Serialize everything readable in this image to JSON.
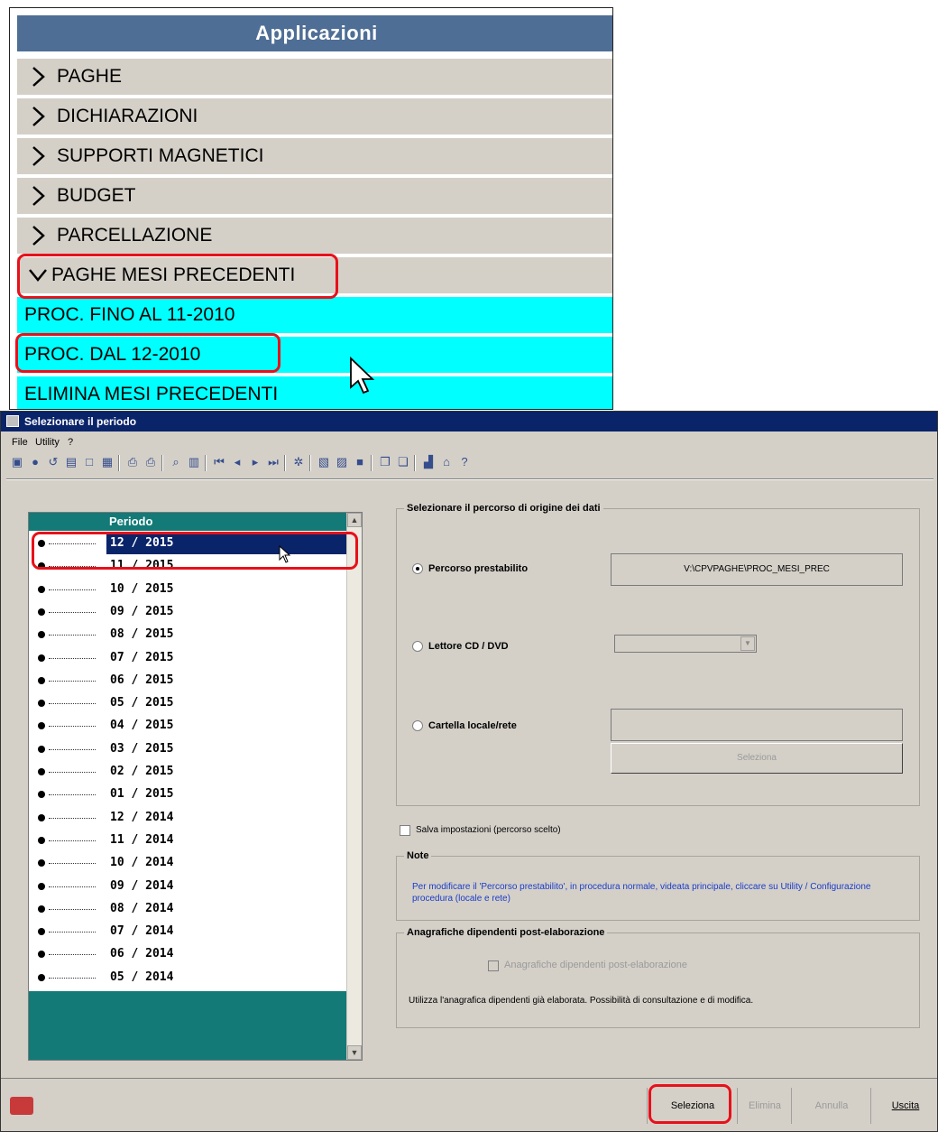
{
  "apps": {
    "header": "Applicazioni",
    "items": [
      {
        "label": "PAGHE"
      },
      {
        "label": "DICHIARAZIONI"
      },
      {
        "label": "SUPPORTI MAGNETICI"
      },
      {
        "label": "BUDGET"
      },
      {
        "label": "PARCELLAZIONE"
      },
      {
        "label": "PAGHE MESI PRECEDENTI"
      }
    ],
    "subitems": [
      {
        "label": "PROC. FINO AL 11-2010"
      },
      {
        "label": "PROC. DAL 12-2010"
      },
      {
        "label": "ELIMINA MESI PRECEDENTI"
      }
    ],
    "highlight_color": "#e8101a",
    "subitem_color": "#00ffff",
    "header_color": "#4f6e95"
  },
  "dialog": {
    "title": "Selezionare il periodo",
    "menu": [
      "File",
      "Utility",
      "?"
    ],
    "list_header": "Periodo",
    "periods": [
      "12 / 2015",
      "11 / 2015",
      "10 / 2015",
      "09 / 2015",
      "08 / 2015",
      "07 / 2015",
      "06 / 2015",
      "05 / 2015",
      "04 / 2015",
      "03 / 2015",
      "02 / 2015",
      "01 / 2015",
      "12 / 2014",
      "11 / 2014",
      "10 / 2014",
      "09 / 2014",
      "08 / 2014",
      "07 / 2014",
      "06 / 2014",
      "05 / 2014"
    ],
    "selected_period": "12 / 2015",
    "origin_group_title": "Selezionare il percorso di origine dei dati",
    "opt_default": "Percorso prestabilito",
    "default_path": "V:\\CPVPAGHE\\PROC_MESI_PREC",
    "opt_cd": "Lettore CD / DVD",
    "opt_folder": "Cartella locale/rete",
    "select_folder_button": "Seleziona",
    "save_settings": "Salva impostazioni (percorso scelto)",
    "note_title": "Note",
    "note_text": "Per modificare il 'Percorso prestabilito', in procedura normale, videata principale, cliccare su Utility / Configurazione procedura (locale e rete)",
    "anag_title": "Anagrafiche dipendenti post-elaborazione",
    "anag_check": "Anagrafiche dipendenti post-elaborazione",
    "anag_text": "Utilizza l'anagrafica dipendenti già elaborata. Possibilità di consultazione e di modifica.",
    "buttons": {
      "select": "Seleziona",
      "delete": "Elimina",
      "cancel": "Annulla",
      "exit": "Uscita"
    },
    "list_header_color": "#137a77",
    "selection_color": "#0a246a"
  }
}
